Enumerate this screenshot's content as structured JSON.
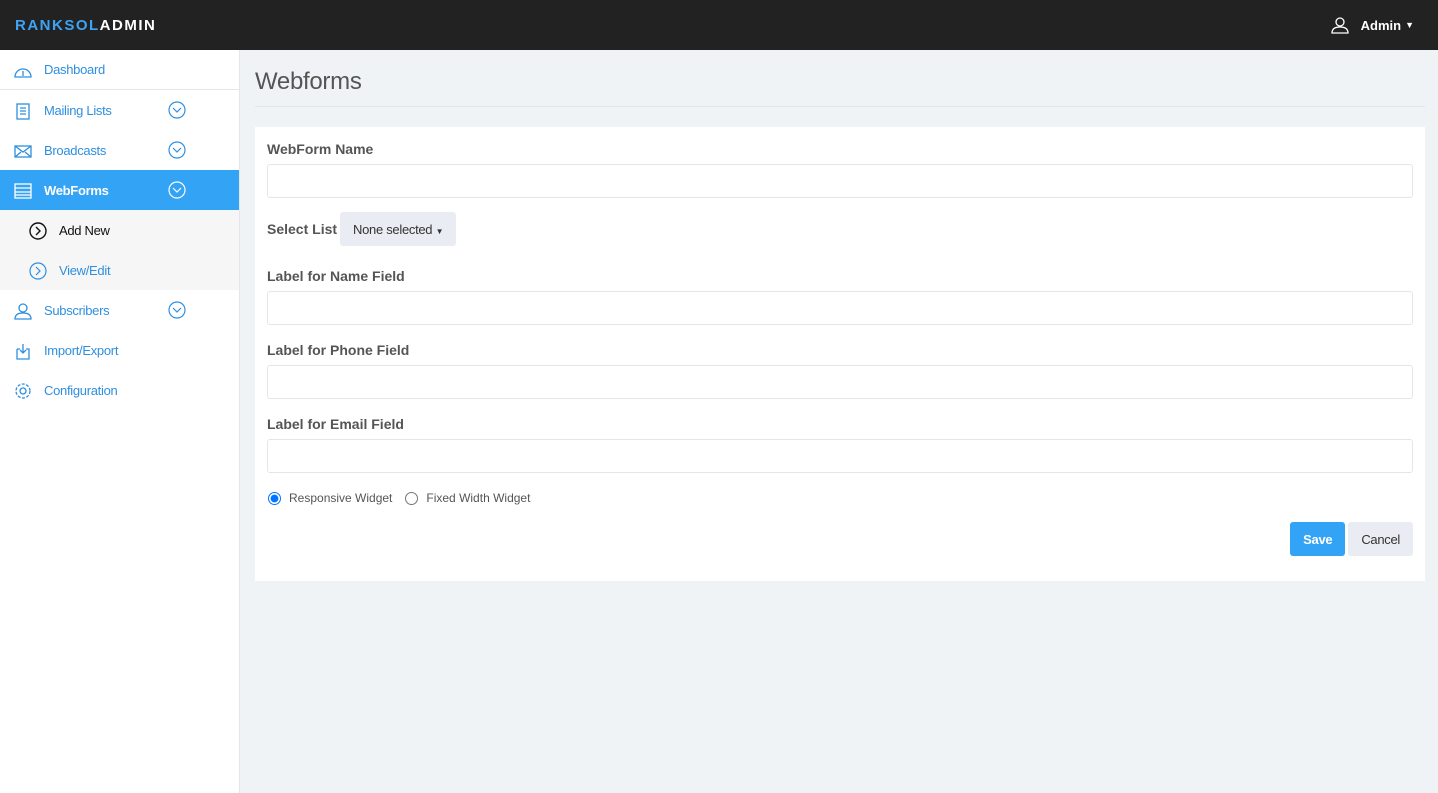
{
  "brand": {
    "part1": "RANKSOL",
    "part2": "ADMIN"
  },
  "user": {
    "name": "Admin"
  },
  "sidebar": {
    "items": [
      {
        "label": "Dashboard"
      },
      {
        "label": "Mailing Lists"
      },
      {
        "label": "Broadcasts"
      },
      {
        "label": "WebForms"
      },
      {
        "label": "Subscribers"
      },
      {
        "label": "Import/Export"
      },
      {
        "label": "Configuration"
      }
    ],
    "sub": [
      {
        "label": "Add New"
      },
      {
        "label": "View/Edit"
      }
    ]
  },
  "page": {
    "title": "Webforms"
  },
  "form": {
    "webform_name_label": "WebForm Name",
    "webform_name_value": "",
    "select_list_label": "Select List",
    "select_list_value": "None selected",
    "name_label": "Label for Name Field",
    "phone_label": "Label for Phone Field",
    "email_label": "Label for Email Field",
    "radio_responsive": "Responsive Widget",
    "radio_fixed": "Fixed Width Widget",
    "save": "Save",
    "cancel": "Cancel"
  },
  "colors": {
    "accent": "#33a3f6",
    "topbar": "#222222"
  }
}
